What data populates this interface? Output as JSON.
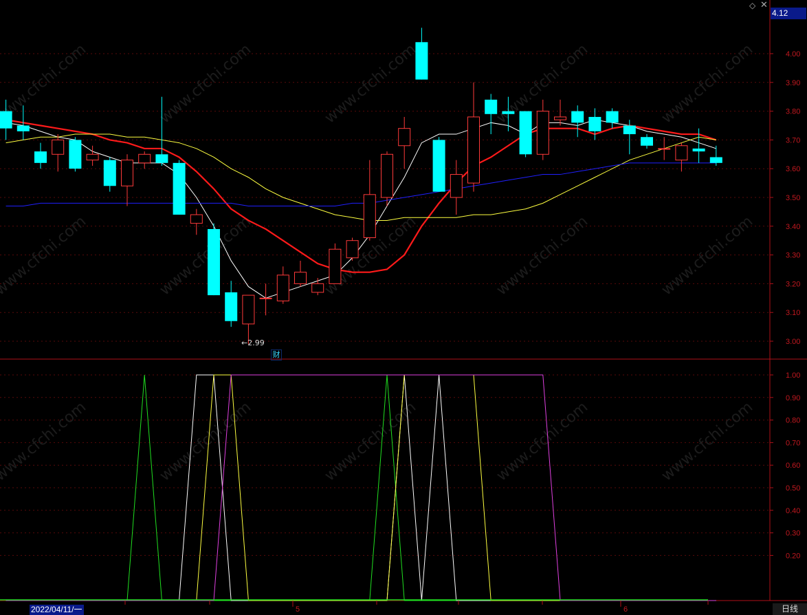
{
  "header": {
    "last_price": "4.12",
    "diamond_icon": "diamond-icon",
    "close_icon": "close-icon"
  },
  "footer": {
    "start_date": "2022/04/11/一",
    "period": "日线",
    "month_labels": [
      "5",
      "6"
    ]
  },
  "annotations": {
    "low_label": "←2.99",
    "cai_tag": "财"
  },
  "colors": {
    "background": "#000000",
    "grid": "#5a0a0a",
    "axis_text": "#c0181f",
    "up": "#ff3a3a",
    "down": "#00ffff",
    "ma5": "#ffffff",
    "ma10": "#ff1a1a",
    "ma20": "#ffff40",
    "ma60": "#2020ff",
    "ind_green": "#20e020",
    "ind_white": "#ffffff",
    "ind_yellow": "#ffff40",
    "ind_magenta": "#e040e0"
  },
  "chart_data": [
    {
      "type": "candlestick",
      "yticks": [
        "4.00",
        "3.90",
        "3.80",
        "3.70",
        "3.60",
        "3.50",
        "3.40",
        "3.30",
        "3.20",
        "3.10",
        "3.00"
      ],
      "ylim": [
        2.93,
        4.12
      ],
      "candles": [
        {
          "o": 3.8,
          "c": 3.74,
          "h": 3.84,
          "l": 3.7
        },
        {
          "o": 3.75,
          "c": 3.73,
          "h": 3.82,
          "l": 3.7
        },
        {
          "o": 3.66,
          "c": 3.62,
          "h": 3.69,
          "l": 3.6
        },
        {
          "o": 3.65,
          "c": 3.7,
          "h": 3.72,
          "l": 3.59
        },
        {
          "o": 3.7,
          "c": 3.6,
          "h": 3.71,
          "l": 3.59
        },
        {
          "o": 3.63,
          "c": 3.65,
          "h": 3.68,
          "l": 3.61
        },
        {
          "o": 3.63,
          "c": 3.54,
          "h": 3.64,
          "l": 3.52
        },
        {
          "o": 3.54,
          "c": 3.63,
          "h": 3.65,
          "l": 3.47
        },
        {
          "o": 3.62,
          "c": 3.65,
          "h": 3.66,
          "l": 3.6
        },
        {
          "o": 3.65,
          "c": 3.62,
          "h": 3.85,
          "l": 3.61
        },
        {
          "o": 3.62,
          "c": 3.44,
          "h": 3.63,
          "l": 3.44
        },
        {
          "o": 3.41,
          "c": 3.44,
          "h": 3.46,
          "l": 3.37
        },
        {
          "o": 3.39,
          "c": 3.16,
          "h": 3.41,
          "l": 3.16
        },
        {
          "o": 3.17,
          "c": 3.07,
          "h": 3.21,
          "l": 3.05
        },
        {
          "o": 3.06,
          "c": 3.16,
          "h": 3.16,
          "l": 2.99
        },
        {
          "o": 3.15,
          "c": 3.15,
          "h": 3.2,
          "l": 3.09
        },
        {
          "o": 3.14,
          "c": 3.23,
          "h": 3.26,
          "l": 3.13
        },
        {
          "o": 3.2,
          "c": 3.24,
          "h": 3.28,
          "l": 3.19
        },
        {
          "o": 3.17,
          "c": 3.2,
          "h": 3.22,
          "l": 3.16
        },
        {
          "o": 3.2,
          "c": 3.32,
          "h": 3.34,
          "l": 3.2
        },
        {
          "o": 3.29,
          "c": 3.35,
          "h": 3.36,
          "l": 3.28
        },
        {
          "o": 3.36,
          "c": 3.51,
          "h": 3.63,
          "l": 3.35
        },
        {
          "o": 3.5,
          "c": 3.65,
          "h": 3.66,
          "l": 3.47
        },
        {
          "o": 3.68,
          "c": 3.74,
          "h": 3.78,
          "l": 3.6
        },
        {
          "o": 4.04,
          "c": 3.91,
          "h": 4.09,
          "l": 3.91
        },
        {
          "o": 3.7,
          "c": 3.52,
          "h": 3.71,
          "l": 3.52
        },
        {
          "o": 3.5,
          "c": 3.58,
          "h": 3.63,
          "l": 3.44
        },
        {
          "o": 3.55,
          "c": 3.78,
          "h": 3.9,
          "l": 3.52
        },
        {
          "o": 3.84,
          "c": 3.79,
          "h": 3.86,
          "l": 3.72
        },
        {
          "o": 3.8,
          "c": 3.79,
          "h": 3.85,
          "l": 3.73
        },
        {
          "o": 3.8,
          "c": 3.65,
          "h": 3.8,
          "l": 3.64
        },
        {
          "o": 3.65,
          "c": 3.8,
          "h": 3.84,
          "l": 3.63
        },
        {
          "o": 3.77,
          "c": 3.78,
          "h": 3.84,
          "l": 3.75
        },
        {
          "o": 3.8,
          "c": 3.76,
          "h": 3.82,
          "l": 3.71
        },
        {
          "o": 3.78,
          "c": 3.73,
          "h": 3.81,
          "l": 3.7
        },
        {
          "o": 3.8,
          "c": 3.76,
          "h": 3.81,
          "l": 3.74
        },
        {
          "o": 3.75,
          "c": 3.72,
          "h": 3.77,
          "l": 3.65
        },
        {
          "o": 3.71,
          "c": 3.68,
          "h": 3.72,
          "l": 3.67
        },
        {
          "o": 3.67,
          "c": 3.67,
          "h": 3.71,
          "l": 3.63
        },
        {
          "o": 3.63,
          "c": 3.68,
          "h": 3.69,
          "l": 3.59
        },
        {
          "o": 3.67,
          "c": 3.66,
          "h": 3.74,
          "l": 3.62
        },
        {
          "o": 3.64,
          "c": 3.62,
          "h": 3.68,
          "l": 3.61
        }
      ],
      "series": [
        {
          "values": [
            3.76,
            3.75,
            3.73,
            3.71,
            3.7,
            3.66,
            3.64,
            3.62,
            3.62,
            3.62,
            3.58,
            3.5,
            3.4,
            3.28,
            3.19,
            3.15,
            3.17,
            3.19,
            3.21,
            3.23,
            3.29,
            3.37,
            3.47,
            3.57,
            3.69,
            3.72,
            3.72,
            3.74,
            3.76,
            3.75,
            3.72,
            3.76,
            3.76,
            3.75,
            3.77,
            3.76,
            3.75,
            3.73,
            3.72,
            3.71,
            3.69,
            3.67
          ]
        },
        {
          "values": [
            3.77,
            3.76,
            3.75,
            3.74,
            3.73,
            3.72,
            3.7,
            3.69,
            3.67,
            3.67,
            3.64,
            3.59,
            3.53,
            3.46,
            3.42,
            3.39,
            3.35,
            3.31,
            3.27,
            3.25,
            3.24,
            3.24,
            3.25,
            3.3,
            3.4,
            3.48,
            3.55,
            3.61,
            3.64,
            3.68,
            3.72,
            3.74,
            3.74,
            3.74,
            3.72,
            3.74,
            3.75,
            3.74,
            3.73,
            3.72,
            3.72,
            3.7
          ]
        },
        {
          "values": [
            3.69,
            3.7,
            3.71,
            3.71,
            3.72,
            3.72,
            3.72,
            3.71,
            3.71,
            3.7,
            3.69,
            3.67,
            3.64,
            3.6,
            3.57,
            3.53,
            3.5,
            3.48,
            3.46,
            3.44,
            3.43,
            3.42,
            3.42,
            3.43,
            3.43,
            3.43,
            3.43,
            3.44,
            3.44,
            3.45,
            3.46,
            3.48,
            3.51,
            3.54,
            3.57,
            3.6,
            3.63,
            3.65,
            3.67,
            3.69,
            3.71,
            3.7
          ]
        },
        {
          "values": [
            3.47,
            3.47,
            3.48,
            3.48,
            3.48,
            3.48,
            3.48,
            3.48,
            3.48,
            3.48,
            3.48,
            3.48,
            3.48,
            3.48,
            3.47,
            3.47,
            3.47,
            3.47,
            3.47,
            3.47,
            3.48,
            3.48,
            3.49,
            3.5,
            3.51,
            3.52,
            3.53,
            3.54,
            3.55,
            3.56,
            3.57,
            3.58,
            3.58,
            3.59,
            3.6,
            3.61,
            3.62,
            3.62,
            3.62,
            3.62,
            3.62,
            3.62
          ]
        }
      ]
    },
    {
      "type": "line",
      "yticks": [
        "1.00",
        "0.90",
        "0.80",
        "0.70",
        "0.60",
        "0.50",
        "0.40",
        "0.30",
        "0.20"
      ],
      "ylim": [
        0,
        1
      ],
      "series": [
        {
          "values": [
            0,
            0,
            0,
            0,
            0,
            0,
            0,
            0,
            1,
            0,
            0,
            0,
            0,
            0,
            0,
            0,
            0,
            0,
            0,
            0,
            0,
            0,
            1,
            0,
            0,
            0,
            0,
            0,
            0,
            0,
            0,
            0,
            0,
            0,
            0,
            0,
            0,
            0,
            0,
            0,
            0,
            0
          ]
        },
        {
          "values": [
            0,
            0,
            0,
            0,
            0,
            0,
            0,
            0,
            0,
            0,
            0,
            1,
            1,
            0,
            0,
            0,
            0,
            0,
            0,
            0,
            0,
            0,
            0,
            1,
            0,
            1,
            0,
            0,
            0,
            0,
            0,
            0,
            0,
            0,
            0,
            0,
            0,
            0,
            0,
            0,
            0,
            0
          ]
        },
        {
          "values": [
            0,
            0,
            0,
            0,
            0,
            0,
            0,
            0,
            0,
            0,
            0,
            0,
            1,
            1,
            0,
            0,
            0,
            0,
            0,
            0,
            0,
            0,
            0,
            1,
            1,
            1,
            1,
            1,
            0,
            0,
            0,
            0,
            0,
            0,
            0,
            0,
            0,
            0,
            0,
            0,
            0,
            0
          ]
        },
        {
          "values": [
            0,
            0,
            0,
            0,
            0,
            0,
            0,
            0,
            0,
            0,
            0,
            0,
            0,
            1,
            1,
            1,
            1,
            1,
            1,
            1,
            1,
            1,
            1,
            1,
            1,
            1,
            1,
            1,
            1,
            1,
            1,
            1,
            0,
            0,
            0,
            0,
            0,
            0,
            0,
            0,
            0,
            0
          ]
        }
      ]
    }
  ]
}
